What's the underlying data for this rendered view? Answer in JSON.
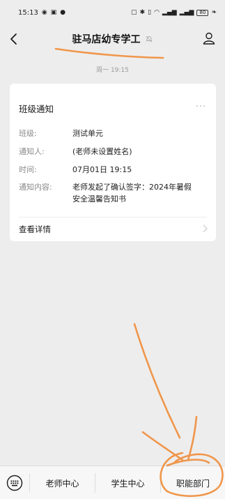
{
  "status_bar": {
    "time": "15:13",
    "battery": "80"
  },
  "nav": {
    "title": "驻马店幼专学工"
  },
  "chat": {
    "timestamp": "周一 19:15"
  },
  "card": {
    "title": "班级通知",
    "more": "···",
    "fields": [
      {
        "label": "班级:",
        "value": "测试单元"
      },
      {
        "label": "通知人:",
        "value": "(老师未设置姓名)"
      },
      {
        "label": "时间:",
        "value": "07月01日 19:15"
      },
      {
        "label": "通知内容:",
        "value_line1": "老师发起了确认签字：2024年暑假",
        "value_line2": "安全温馨告知书"
      }
    ],
    "detail_link": "查看详情"
  },
  "bottom_menu": {
    "items": [
      "老师中心",
      "学生中心",
      "职能部门"
    ]
  },
  "colors": {
    "background": "#ededed",
    "card": "#ffffff",
    "annotation_orange": "#f0964a"
  },
  "icons": [
    "back-arrow-icon",
    "mute-bell-icon",
    "profile-icon",
    "keyboard-icon",
    "chevron-right-icon"
  ]
}
